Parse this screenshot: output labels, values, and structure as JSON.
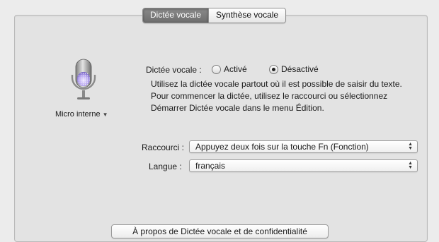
{
  "tabs": [
    {
      "label": "Dictée vocale",
      "active": true
    },
    {
      "label": "Synthèse vocale",
      "active": false
    }
  ],
  "mic": {
    "icon": "microphone-icon",
    "source_label": "Micro interne",
    "caret": "▼"
  },
  "dictation": {
    "label": "Dictée vocale :",
    "on_label": "Activé",
    "off_label": "Désactivé",
    "selected": "off",
    "description": "Utilisez la dictée vocale partout où il est possible de saisir du texte. Pour commencer la dictée, utilisez le raccourci ou sélectionnez Démarrer Dictée vocale dans le menu Édition."
  },
  "shortcut": {
    "label": "Raccourci :",
    "value": "Appuyez deux fois sur la touche Fn (Fonction)"
  },
  "language": {
    "label": "Langue :",
    "value": "français"
  },
  "about_button": {
    "label": "À propos de Dictée vocale et de confidentialité"
  },
  "colors": {
    "accent_tab": "#7a7a7a",
    "mic_glow": "#b8a6f0",
    "background": "#ececec"
  }
}
